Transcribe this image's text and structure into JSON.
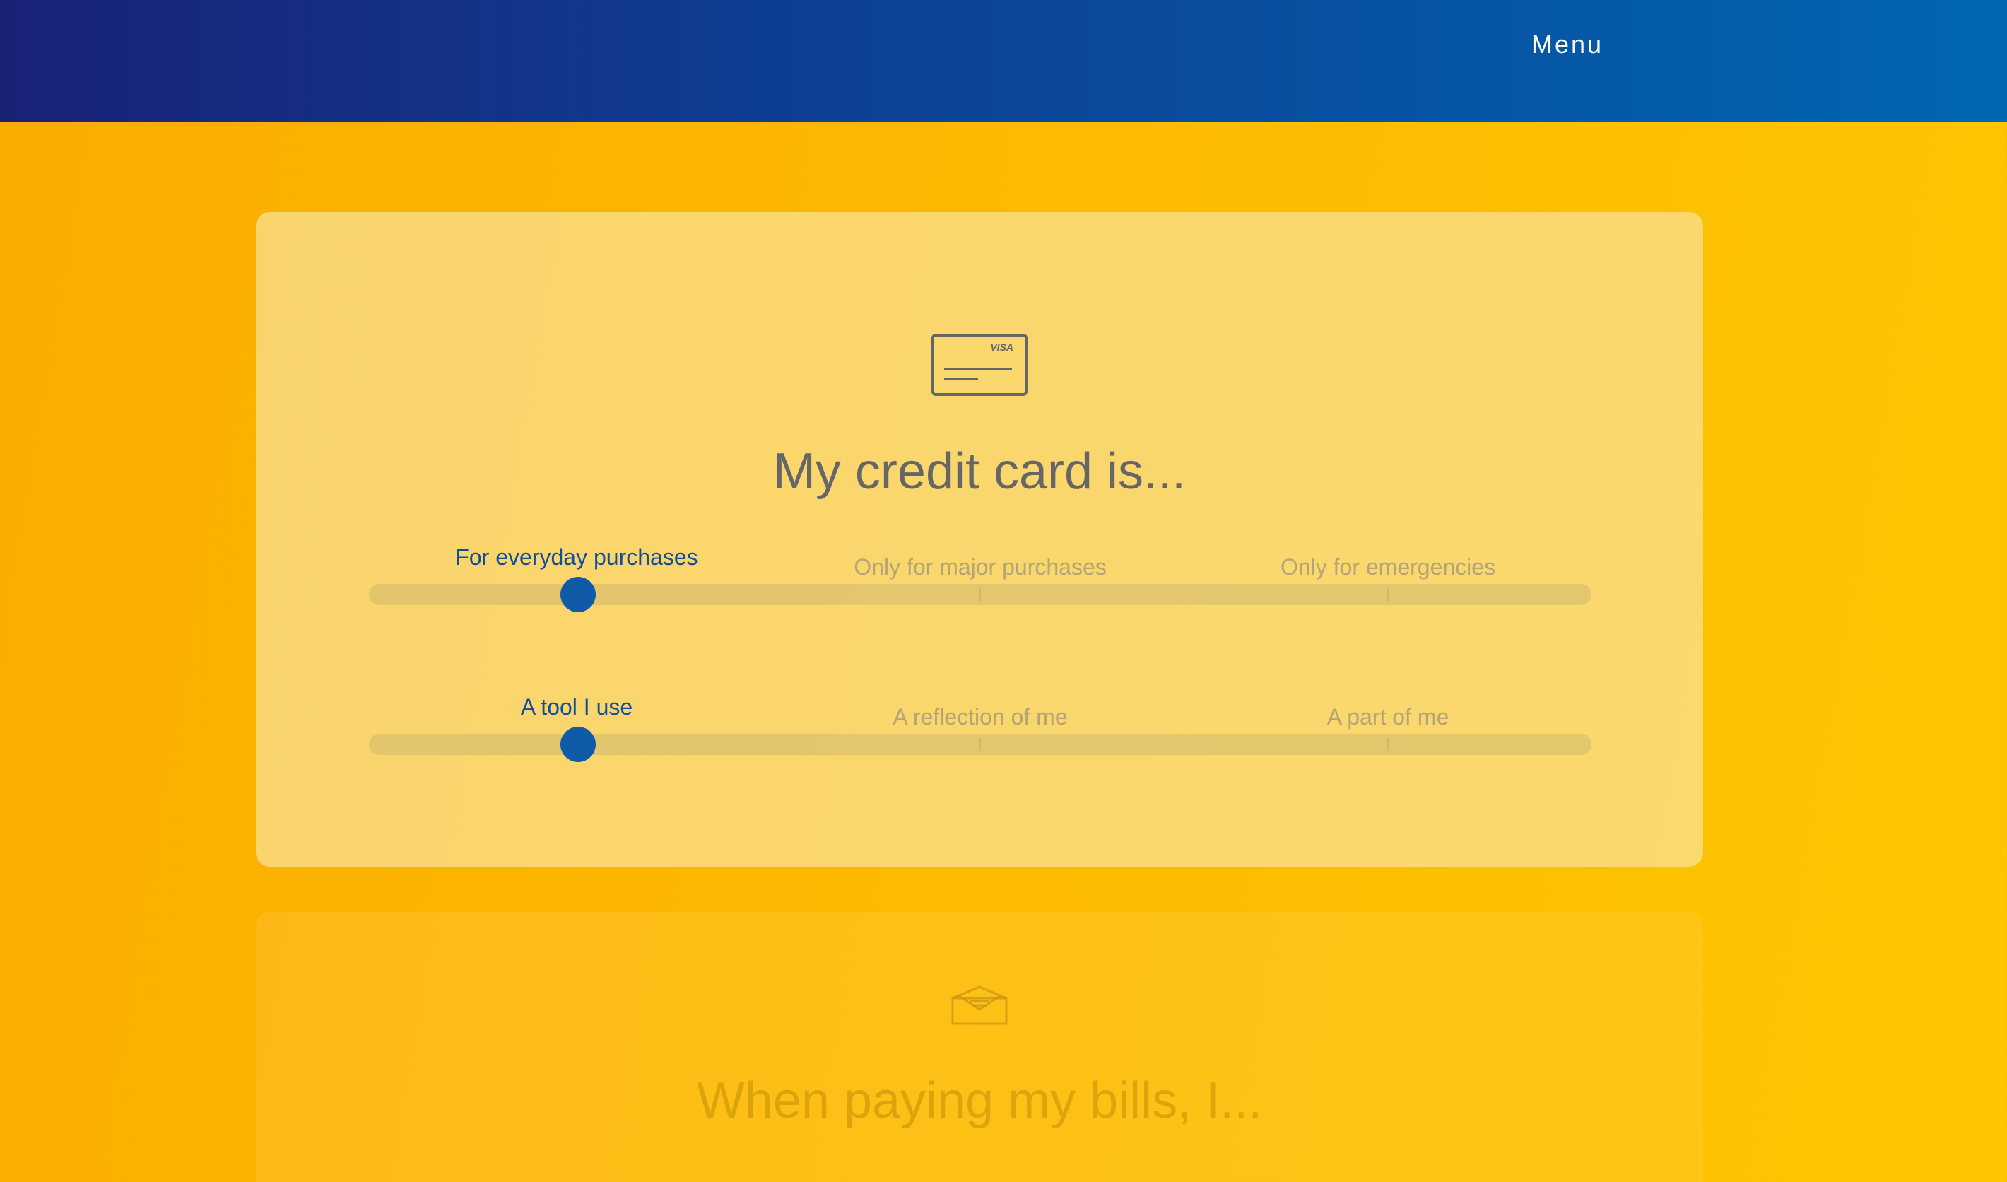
{
  "header": {
    "menu_label": "Menu"
  },
  "colors": {
    "header_start": "#1a2276",
    "header_end": "#0067b3",
    "page_bg": "#fcb900",
    "accent": "#0f5ba8",
    "selected_text": "#0f4f9a"
  },
  "card1": {
    "icon": "credit-card-icon",
    "icon_text": "VISA",
    "title": "My credit card is...",
    "slider1": {
      "options": [
        "For everyday purchases",
        "Only for major purchases",
        "Only for emergencies"
      ],
      "selected_index": 0,
      "value": 0.17
    },
    "slider2": {
      "options": [
        "A tool I use",
        "A reflection of me",
        "A part of me"
      ],
      "selected_index": 0,
      "value": 0.17
    }
  },
  "card2": {
    "icon": "envelope-icon",
    "title": "When paying my bills, I..."
  }
}
